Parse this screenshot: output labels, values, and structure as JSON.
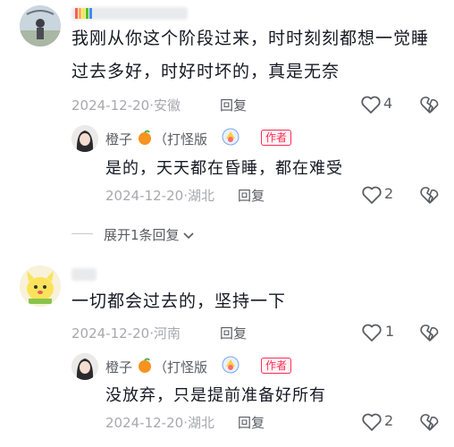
{
  "colors": {
    "author_tag": "#fe2c55",
    "meta": "#a7a8ad",
    "text": "#161823",
    "orange": "#f7931e"
  },
  "comments": [
    {
      "text_line1": "我刚从你这个阶段过来，时时刻刻都想一觉睡",
      "text_line2": "过去多好，时好时坏的，真是无奈",
      "date": "2024-12-20",
      "location": "安徽",
      "reply_label": "回复",
      "likes": "4",
      "reply": {
        "user": "橙子",
        "tag": "（打怪版",
        "author_label": "作者",
        "text": "是的，天天都在昏睡，都在难受",
        "date": "2024-12-20",
        "location": "湖北",
        "reply_label": "回复",
        "likes": "2"
      }
    },
    {
      "text": "一切都会过去的，坚持一下",
      "date": "2024-12-20",
      "location": "河南",
      "reply_label": "回复",
      "likes": "1",
      "reply": {
        "user": "橙子",
        "tag": "（打怪版",
        "author_label": "作者",
        "text": "没放弃，只是提前准备好所有",
        "date": "2024-12-20",
        "location": "湖北",
        "reply_label": "回复",
        "likes": "2"
      }
    }
  ],
  "expand_replies": "展开1条回复",
  "separator": "·",
  "icons": {
    "like": "heart-outline-icon",
    "dislike": "broken-heart-icon",
    "expand": "chevron-down-icon",
    "fruit": "orange-icon"
  }
}
